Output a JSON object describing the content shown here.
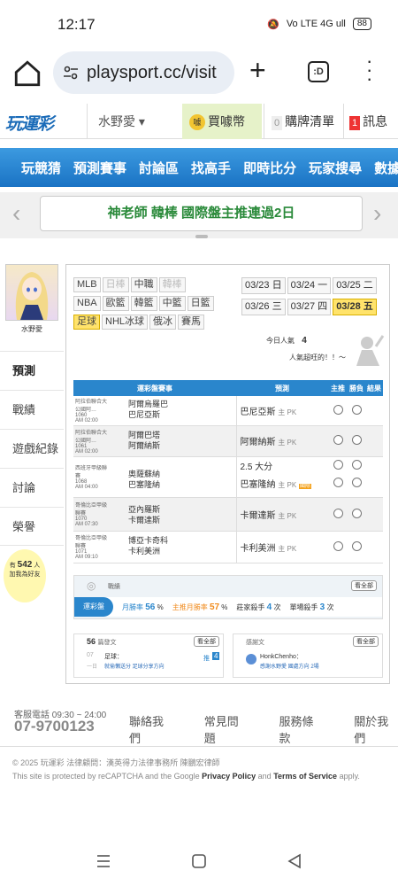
{
  "status_bar": {
    "time": "12:17",
    "indicators": "Vo LTE 4G ull",
    "battery": "88"
  },
  "browser": {
    "url": "playsport.cc/visit",
    "tabs_count": ":D"
  },
  "topnav": {
    "logo": "玩運彩",
    "username": "水野愛 ▾",
    "buy_coin": "買噱幣",
    "coin_icon": "噱",
    "cart_count": "0",
    "cart_label": "購牌清單",
    "msg_count": "1",
    "msg_label": "訊息"
  },
  "bluenav": [
    "玩競猜",
    "預測賽事",
    "討論區",
    "找高手",
    "即時比分",
    "玩家搜尋",
    "數據"
  ],
  "promo": {
    "text": "神老師 韓棒 國際盤主推連過2日"
  },
  "profile": {
    "name": "水野愛"
  },
  "leftmenu": [
    "預測",
    "戰績",
    "遊戲紀錄",
    "討論",
    "榮譽"
  ],
  "bulb": {
    "prefix": "有",
    "count": "542",
    "suffix": "人",
    "line2": "加我為好友"
  },
  "sports": [
    [
      "MLB",
      "日棒",
      "中職",
      "韓棒"
    ],
    [
      "NBA",
      "歐籃",
      "韓籃",
      "中籃",
      "日籃"
    ],
    [
      "足球",
      "NHL冰球",
      "俄冰",
      "賽馬"
    ]
  ],
  "dates": [
    [
      "03/23 日",
      "03/24 一",
      "03/25 二"
    ],
    [
      "03/26 三",
      "03/27 四",
      "03/28 五"
    ]
  ],
  "popular": {
    "label": "今日人氣",
    "count": "4",
    "tagline": "人氣超旺的！！～"
  },
  "table": {
    "headers": [
      "運彩盤賽事",
      "預測",
      "主推",
      "勝負",
      "結果"
    ],
    "rows": [
      {
        "league": "阿拉伯聯合大公國阿…",
        "no": "1060",
        "time": "AM 02:00",
        "home": "阿爾烏羅巴",
        "away": "巴尼亞斯",
        "pick": "巴尼亞斯",
        "pick_type": "主 PK"
      },
      {
        "league": "阿拉伯聯合大公國阿…",
        "no": "1061",
        "time": "AM 02:00",
        "home": "阿爾巴塔",
        "away": "阿爾納斯",
        "pick": "阿爾納斯",
        "pick_type": "主 PK"
      },
      {
        "league": "西班牙甲級聯賽",
        "no": "1068",
        "time": "AM 04:00",
        "home": "奧薩蘇納",
        "away": "巴塞隆納",
        "pick": "2.5 大分",
        "pick_type": "",
        "pick2": "巴塞隆納",
        "pick2_type": "主 PK",
        "badge": "國際"
      },
      {
        "league": "哥倫比亞甲級聯賽",
        "no": "1070",
        "time": "AM 07:30",
        "home": "亞內羅斯",
        "away": "卡爾達斯",
        "pick": "卡爾達斯",
        "pick_type": "主 PK"
      },
      {
        "league": "哥倫比亞甲級聯賽",
        "no": "1071",
        "time": "AM 09:10",
        "home": "博亞卡奇科",
        "away": "卡利美洲",
        "pick": "卡利美洲",
        "pick_type": "主 PK"
      }
    ]
  },
  "stats": {
    "title": "戰績",
    "more": "看全部",
    "tab": "運彩盤",
    "month_label": "月勝率",
    "month_val": "56",
    "main_label": "主推月勝率",
    "main_val": "57",
    "mk_label": "莊家殺手",
    "mk_val": "4",
    "single_label": "單場殺手",
    "single_val": "3",
    "unit": "次"
  },
  "recent_left": {
    "count": "56",
    "title": "篇發文",
    "more": "看全部",
    "date": "07",
    "time": "一日",
    "topic": "足球：",
    "text": "就偷懶送分 足球分享方向",
    "reply": "4"
  },
  "recent_right": {
    "title": "感謝文",
    "more": "看全部",
    "name": "HonkChenho：",
    "text": "感謝水野愛 國處方向 2場"
  },
  "footer": {
    "service": "客服電話 09:30 ~ 24:00",
    "phone": "07-9700123",
    "links": [
      "聯絡我們",
      "常見問題",
      "服務條款",
      "關於我們"
    ],
    "copyright": "© 2025 玩運彩 法律顧問：漢英得力法律事務所 陳鵬宏律師",
    "recaptcha_pre": "This site is protected by reCAPTCHA and the Google ",
    "privacy": "Privacy Policy",
    "and": " and ",
    "terms": "Terms of Service",
    "apply": " apply."
  }
}
